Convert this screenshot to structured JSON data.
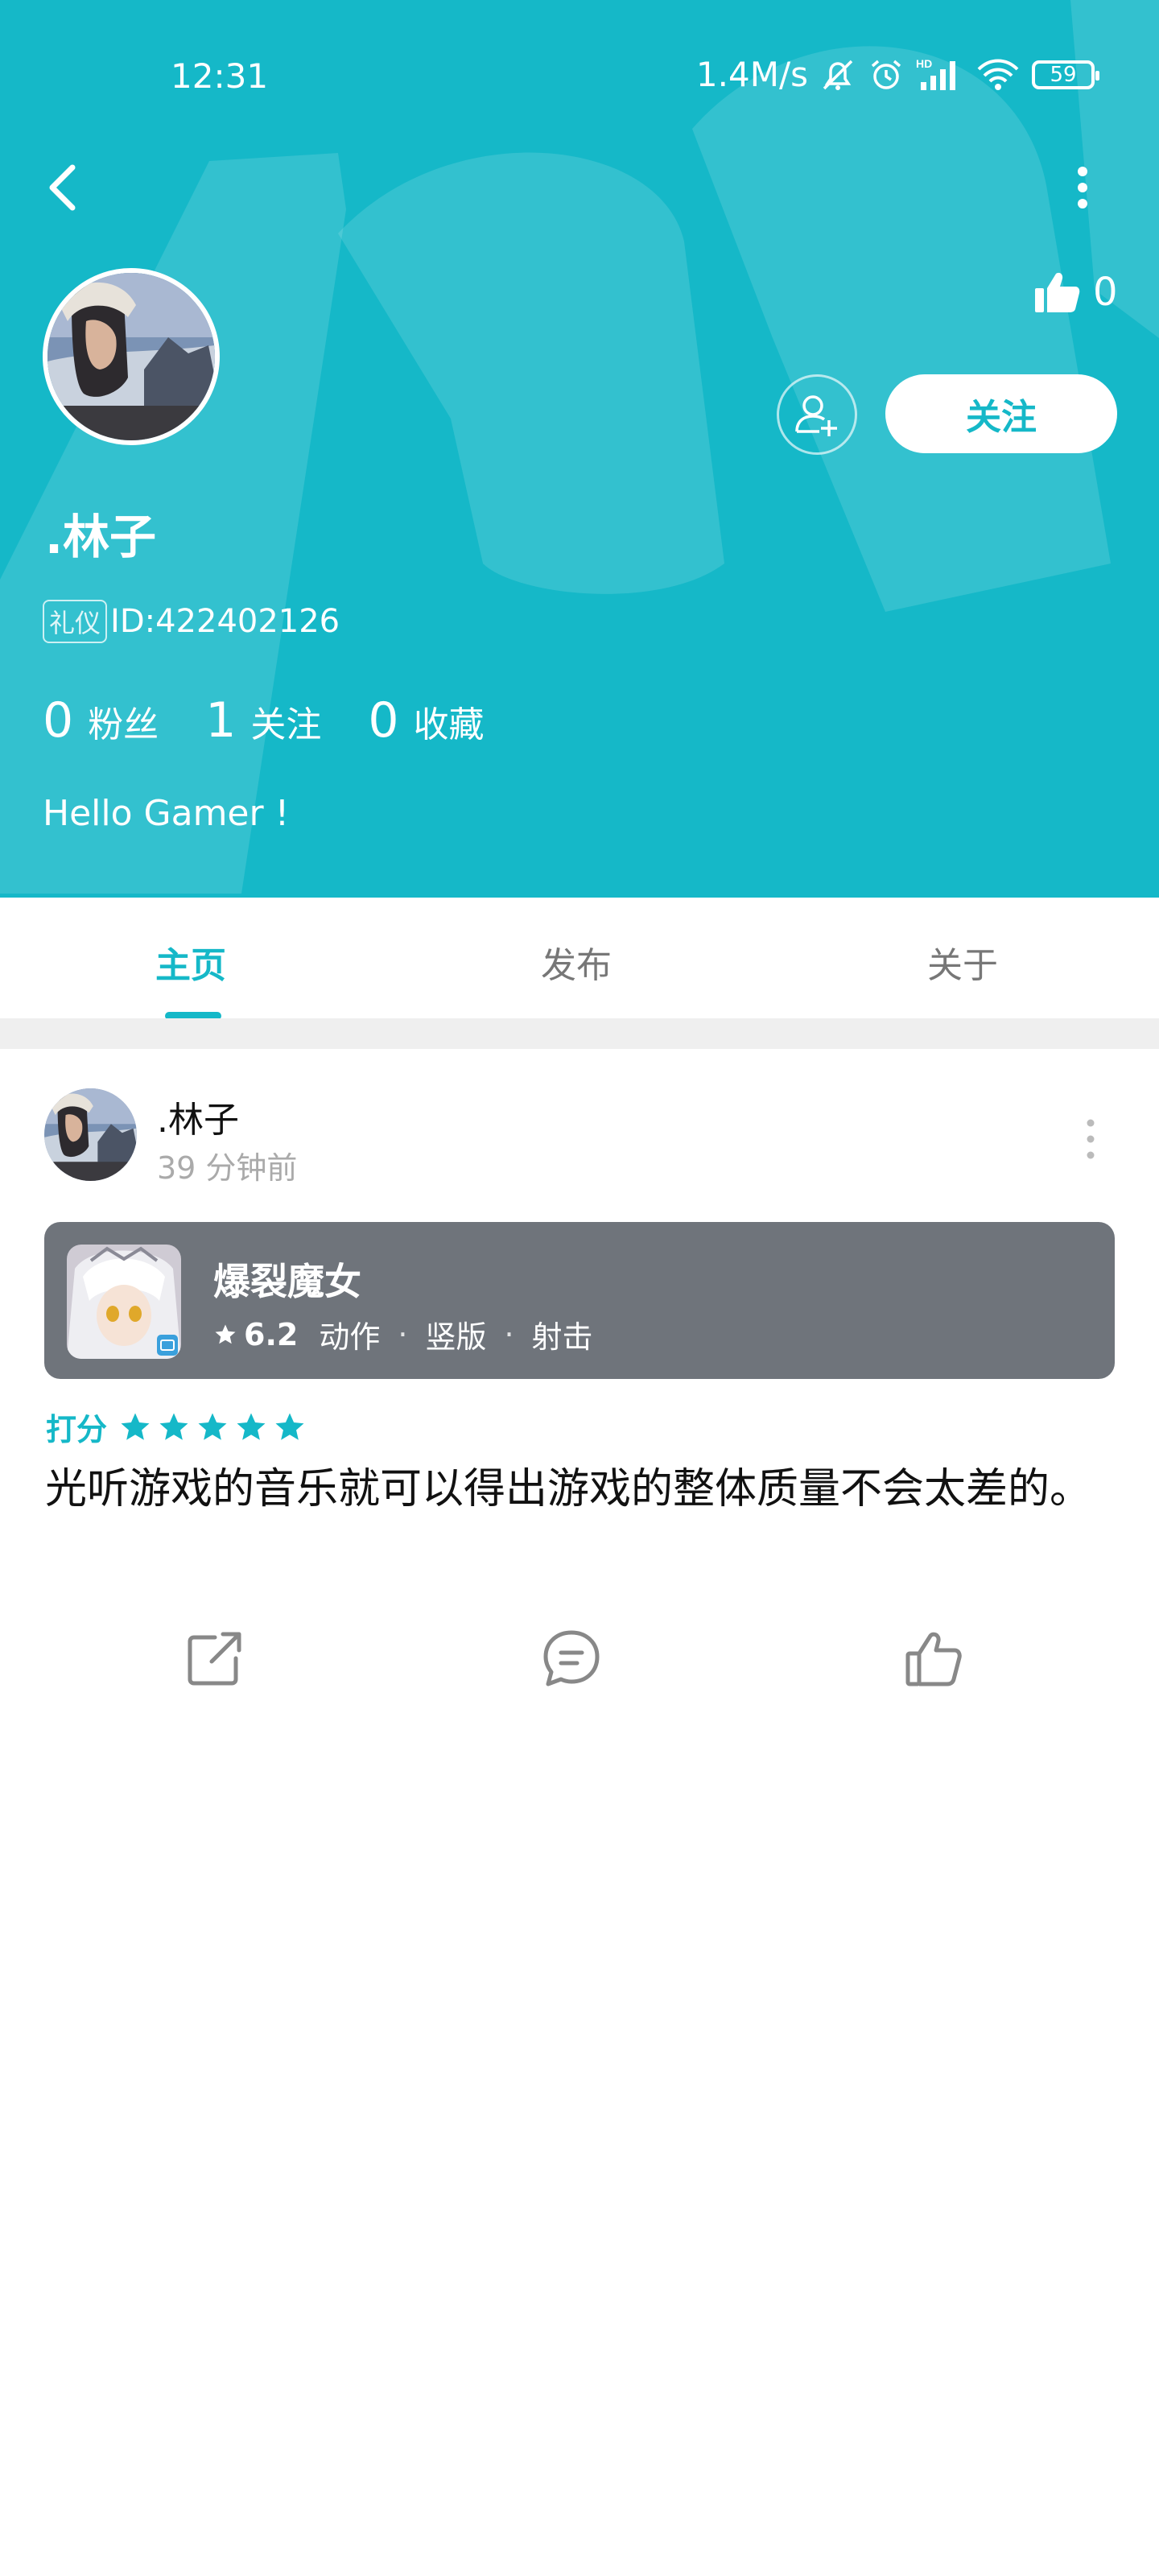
{
  "status_bar": {
    "time": "12:31",
    "speed": "1.4M/s",
    "battery": "59"
  },
  "profile": {
    "name": ".林子",
    "badge": "礼仪",
    "id_text": "ID:422402126",
    "likes": "0",
    "follow_label": "关注",
    "stats": [
      {
        "num": "0",
        "label": "粉丝"
      },
      {
        "num": "1",
        "label": "关注"
      },
      {
        "num": "0",
        "label": "收藏"
      }
    ],
    "bio": "Hello Gamer !"
  },
  "tabs": [
    {
      "label": "主页",
      "active": true
    },
    {
      "label": "发布",
      "active": false
    },
    {
      "label": "关于",
      "active": false
    }
  ],
  "post": {
    "user": ".林子",
    "time": "39 分钟前",
    "game": {
      "name": "爆裂魔女",
      "score": "6.2",
      "tags": [
        "动作",
        "竖版",
        "射击"
      ]
    },
    "rating_label": "打分",
    "rating_stars": 5,
    "text": "光听游戏的音乐就可以得出游戏的整体质量不会太差的。"
  },
  "colors": {
    "accent": "#15b8c8",
    "card": "#6f747b"
  }
}
